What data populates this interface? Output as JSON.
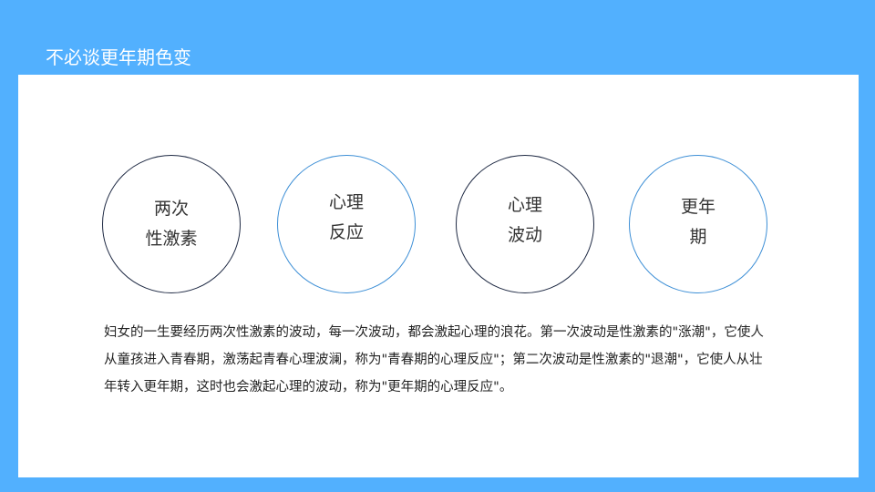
{
  "slide": {
    "title": "不必谈更年期色变",
    "circles": [
      {
        "line1": "两次",
        "line2": "性激素"
      },
      {
        "line1": "心理",
        "line2": "反应"
      },
      {
        "line1": "心理",
        "line2": "波动"
      },
      {
        "line1": "更年",
        "line2": "期"
      }
    ],
    "body": "妇女的一生要经历两次性激素的波动，每一次波动，都会激起心理的浪花。第一次波动是性激素的\"涨潮\"，它使人从童孩进入青春期，激荡起青春心理波澜，称为\"青春期的心理反应\"；第二次波动是性激素的\"退潮\"，它使人从壮年转入更年期，这时也会激起心理的波动，称为\"更年期的心理反应\"。"
  },
  "colors": {
    "frame": "#52b0fe",
    "panel": "#ffffff",
    "circle_dark_border": "#1f2a44",
    "circle_blue_border": "#3d8fd6",
    "text": "#222222"
  }
}
